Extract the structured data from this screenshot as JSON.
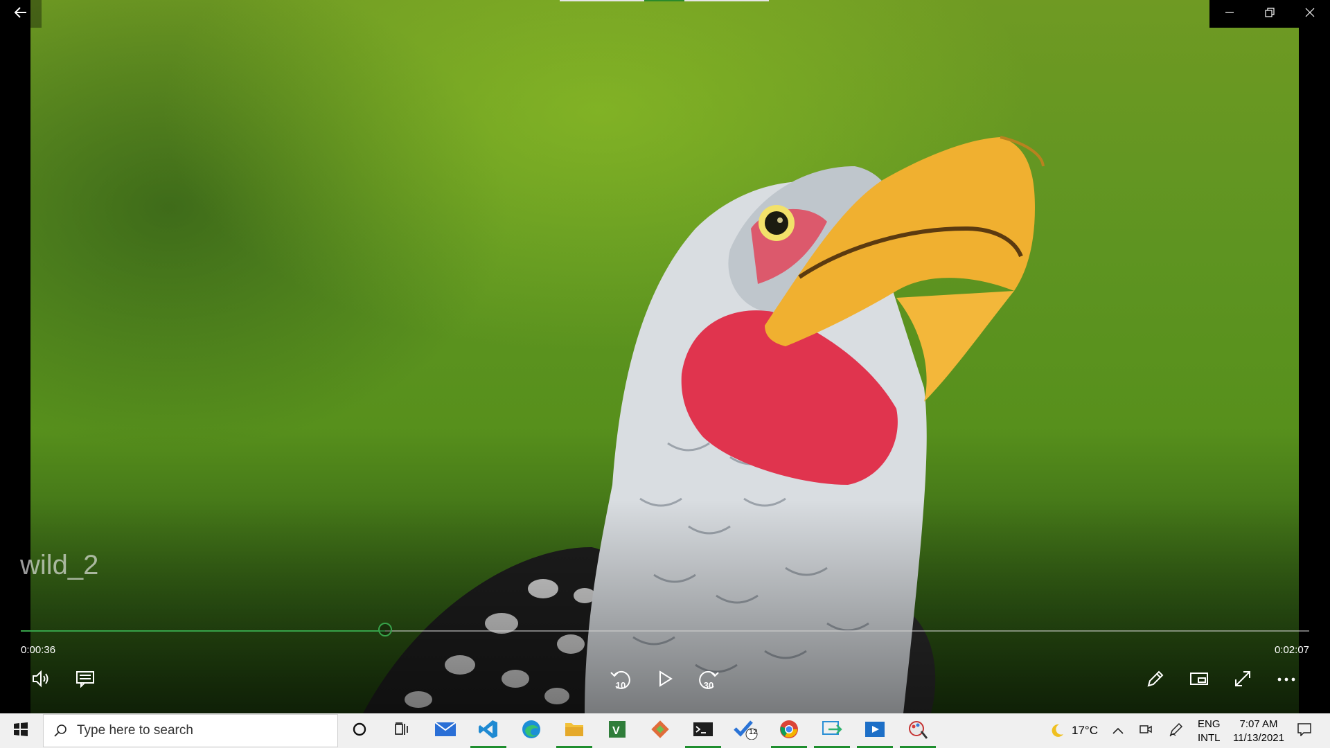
{
  "window": {
    "back_icon": "back-arrow-icon",
    "controls": [
      "minimize-icon",
      "restore-icon",
      "close-icon"
    ]
  },
  "video": {
    "title": "wild_2",
    "progress_fraction": 0.283,
    "elapsed": "0:00:36",
    "duration": "0:02:07",
    "accent_color": "#37a34a"
  },
  "controls": {
    "rewind_seconds": "10",
    "forward_seconds": "30",
    "left": [
      "volume-icon",
      "subtitles-icon"
    ],
    "center": [
      "skip-back-icon",
      "play-icon",
      "skip-forward-icon"
    ],
    "right": [
      "edit-pencil-icon",
      "mini-view-icon",
      "fullscreen-icon",
      "more-options-icon"
    ]
  },
  "taskbar": {
    "search_placeholder": "Type here to search",
    "apps": [
      "cortana-icon",
      "task-view-icon",
      "mail-icon",
      "vscode-icon",
      "edge-icon",
      "file-explorer-icon",
      "visio-icon",
      "git-icon",
      "terminal-icon",
      "todo-icon",
      "chrome-icon",
      "snip-icon",
      "movies-tv-icon",
      "paint-icon"
    ],
    "todo_badge": "12",
    "weather_temp": "17°C",
    "lang_top": "ENG",
    "lang_bottom": "INTL",
    "time": "7:07 AM",
    "date": "11/13/2021"
  }
}
